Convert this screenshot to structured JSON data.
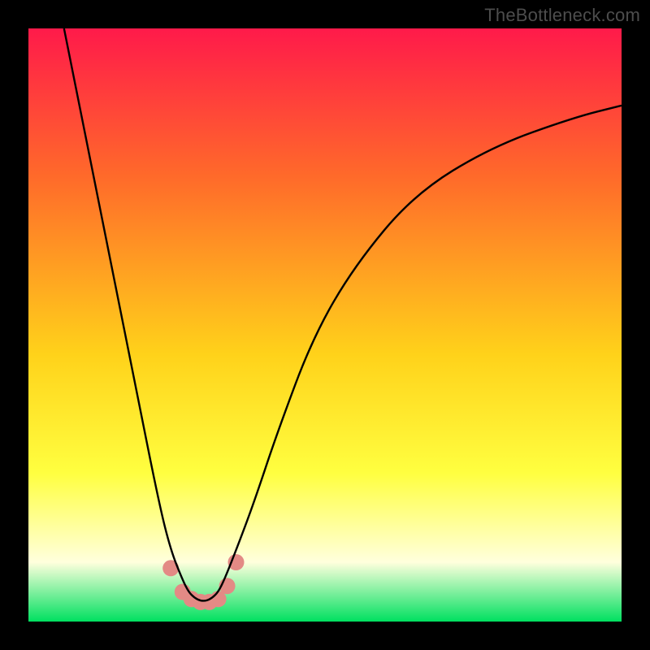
{
  "watermark": "TheBottleneck.com",
  "colors": {
    "frame": "#000000",
    "grad_top": "#ff1a4a",
    "grad_mid_upper": "#ff6a2a",
    "grad_mid": "#ffd21a",
    "grad_mid_lower": "#ffff40",
    "grad_pale": "#ffffdd",
    "grad_bottom": "#00e060",
    "curve": "#000000",
    "marker": "#e38a85"
  },
  "chart_data": {
    "type": "line",
    "title": "",
    "xlabel": "",
    "ylabel": "",
    "xlim": [
      0,
      100
    ],
    "ylim": [
      0,
      100
    ],
    "series": [
      {
        "name": "bottleneck-curve",
        "x": [
          6,
          10,
          14,
          18,
          22,
          24,
          26,
          27,
          28,
          29,
          30,
          31,
          32,
          33,
          35,
          38,
          42,
          48,
          55,
          65,
          78,
          92,
          100
        ],
        "y": [
          100,
          80,
          60,
          40,
          20,
          12,
          7,
          5,
          4,
          3.5,
          3.5,
          4,
          5,
          7,
          12,
          20,
          32,
          48,
          60,
          72,
          80,
          85,
          87
        ]
      }
    ],
    "markers": {
      "name": "highlight-points",
      "x": [
        24,
        26,
        27.5,
        29,
        30.5,
        32,
        33.5,
        35
      ],
      "y": [
        9,
        5,
        3.8,
        3.3,
        3.3,
        3.8,
        6,
        10
      ]
    },
    "background_gradient": {
      "dir": "top-to-bottom",
      "stops": [
        {
          "pos": 0.0,
          "color": "#ff1a4a"
        },
        {
          "pos": 0.25,
          "color": "#ff6a2a"
        },
        {
          "pos": 0.55,
          "color": "#ffd21a"
        },
        {
          "pos": 0.75,
          "color": "#ffff40"
        },
        {
          "pos": 0.9,
          "color": "#ffffdd"
        },
        {
          "pos": 1.0,
          "color": "#00e060"
        }
      ]
    }
  }
}
